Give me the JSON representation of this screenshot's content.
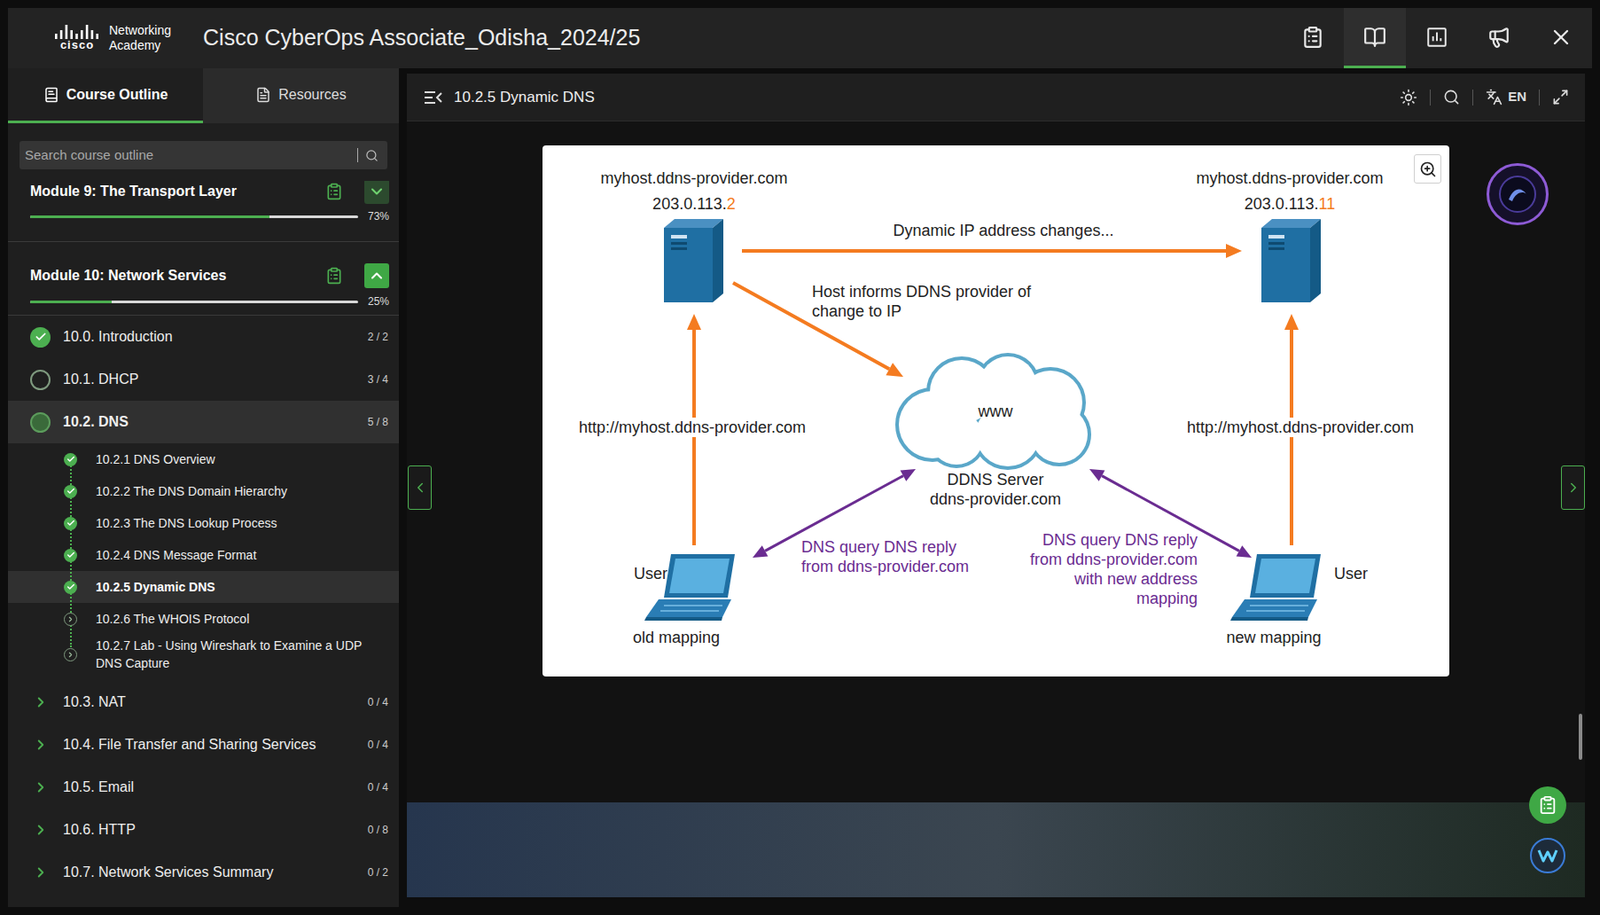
{
  "top_bar": {
    "logo": {
      "brand": "cisco",
      "line1": "Networking",
      "line2": "Academy"
    },
    "title": "Cisco CyberOps Associate_Odisha_2024/25",
    "tools": [
      {
        "kind": "assignments",
        "selected": false
      },
      {
        "kind": "course",
        "selected": true
      },
      {
        "kind": "grades",
        "selected": false
      },
      {
        "kind": "announcements",
        "selected": false
      },
      {
        "kind": "close",
        "selected": false
      }
    ]
  },
  "sidebar": {
    "tabs": [
      {
        "label": "Course Outline",
        "selected": true
      },
      {
        "label": "Resources",
        "selected": false
      }
    ],
    "search": {
      "placeholder": "Search course outline"
    },
    "modules": [
      {
        "title": "Module 9: The Transport Layer",
        "level": 0.73,
        "percent": "73%",
        "expanded": false,
        "sections": []
      },
      {
        "title": "Module 10: Network Services",
        "level": 0.25,
        "percent": "25%",
        "expanded": true,
        "sections": [
          {
            "label": "10.0. Introduction",
            "count": "2 / 2",
            "status": "complete",
            "selected": false,
            "expanded": false,
            "pages": []
          },
          {
            "label": "10.1. DHCP",
            "count": "3 / 4",
            "status": "started",
            "selected": false,
            "expanded": false,
            "pages": []
          },
          {
            "label": "10.2. DNS",
            "count": "5 / 8",
            "status": "current",
            "selected": true,
            "expanded": true,
            "pages": [
              {
                "label": "10.2.1 DNS Overview",
                "complete": true,
                "selected": false
              },
              {
                "label": "10.2.2 The DNS Domain Hierarchy",
                "complete": true,
                "selected": false
              },
              {
                "label": "10.2.3 The DNS Lookup Process",
                "complete": true,
                "selected": false
              },
              {
                "label": "10.2.4 DNS Message Format",
                "complete": true,
                "selected": false
              },
              {
                "label": "10.2.5 Dynamic DNS",
                "complete": true,
                "selected": true
              },
              {
                "label": "10.2.6 The WHOIS Protocol",
                "complete": false,
                "selected": false
              },
              {
                "label": "10.2.7 Lab - Using Wireshark to Examine a UDP DNS Capture",
                "complete": false,
                "selected": false
              }
            ]
          },
          {
            "label": "10.3. NAT",
            "count": "0 / 4",
            "status": "not-started",
            "selected": false,
            "expanded": false,
            "pages": []
          },
          {
            "label": "10.4. File Transfer and Sharing Services",
            "count": "0 / 4",
            "status": "not-started",
            "selected": false,
            "expanded": false,
            "pages": []
          },
          {
            "label": "10.5. Email",
            "count": "0 / 4",
            "status": "not-started",
            "selected": false,
            "expanded": false,
            "pages": []
          },
          {
            "label": "10.6. HTTP",
            "count": "0 / 8",
            "status": "not-started",
            "selected": false,
            "expanded": false,
            "pages": []
          },
          {
            "label": "10.7. Network Services Summary",
            "count": "0 / 2",
            "status": "not-started",
            "selected": false,
            "expanded": false,
            "pages": []
          }
        ]
      }
    ]
  },
  "main": {
    "header": {
      "title": "10.2.5 Dynamic DNS",
      "language": "EN"
    },
    "diagram": {
      "hosts": [
        {
          "name": "myhost.ddns-provider.com",
          "ip_prefix": "203.0.113.",
          "ip_suffix": "2"
        },
        {
          "name": "myhost.ddns-provider.com",
          "ip_prefix": "203.0.113.",
          "ip_suffix": "11"
        }
      ],
      "change_label": "Dynamic IP address changes...",
      "inform_label": [
        "Host informs DDNS provider of",
        "change to IP"
      ],
      "cloud_label": "www",
      "server_label": [
        "DDNS Server",
        "ddns-provider.com"
      ],
      "users": [
        {
          "label": "User",
          "url": "http://myhost.ddns-provider.com",
          "mapping": "old mapping",
          "reply": [
            "DNS query DNS reply",
            "from ddns-provider.com"
          ]
        },
        {
          "label": "User",
          "url": "http://myhost.ddns-provider.com",
          "mapping": "new mapping",
          "reply": [
            "DNS query DNS reply",
            "from ddns-provider.com",
            "with new address",
            "mapping"
          ]
        }
      ]
    }
  }
}
